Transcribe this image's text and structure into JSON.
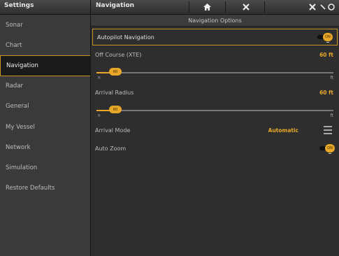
{
  "topbar": {
    "settings_title": "Settings",
    "nav_title": "Navigation",
    "home_icon": "home-icon",
    "close_icon": "close-icon",
    "right_icons": "right-status-icons"
  },
  "sidebar": {
    "items": [
      {
        "label": "Sonar"
      },
      {
        "label": "Chart"
      },
      {
        "label": "Navigation"
      },
      {
        "label": "Radar"
      },
      {
        "label": "General"
      },
      {
        "label": "My Vessel"
      },
      {
        "label": "Network"
      },
      {
        "label": "Simulation"
      },
      {
        "label": "Restore Defaults"
      }
    ],
    "active_index": 2
  },
  "panel": {
    "header": "Navigation Options",
    "autopilot": {
      "label": "Autopilot Navigation",
      "toggle_text": "ON",
      "state": "on"
    },
    "off_course": {
      "label": "Off Course (XTE)",
      "value": "60 ft"
    },
    "off_course_slider": {
      "knob_text": "60",
      "min_label": "ft",
      "max_label": "ft",
      "level": 0.1
    },
    "arrival_radius": {
      "label": "Arrival Radius",
      "value": "60 ft"
    },
    "arrival_slider": {
      "knob_text": "60",
      "min_label": "ft",
      "max_label": "ft",
      "level": 0.1
    },
    "arrival_mode": {
      "label": "Arrival Mode",
      "value": "Automatic"
    },
    "auto_zoom": {
      "label": "Auto Zoom",
      "toggle_text": "ON",
      "state": "on"
    }
  },
  "colors": {
    "accent": "#e8a728",
    "highlight_border": "#c99522",
    "background": "#2e2e2e",
    "sidebar": "#3a3a3a"
  }
}
